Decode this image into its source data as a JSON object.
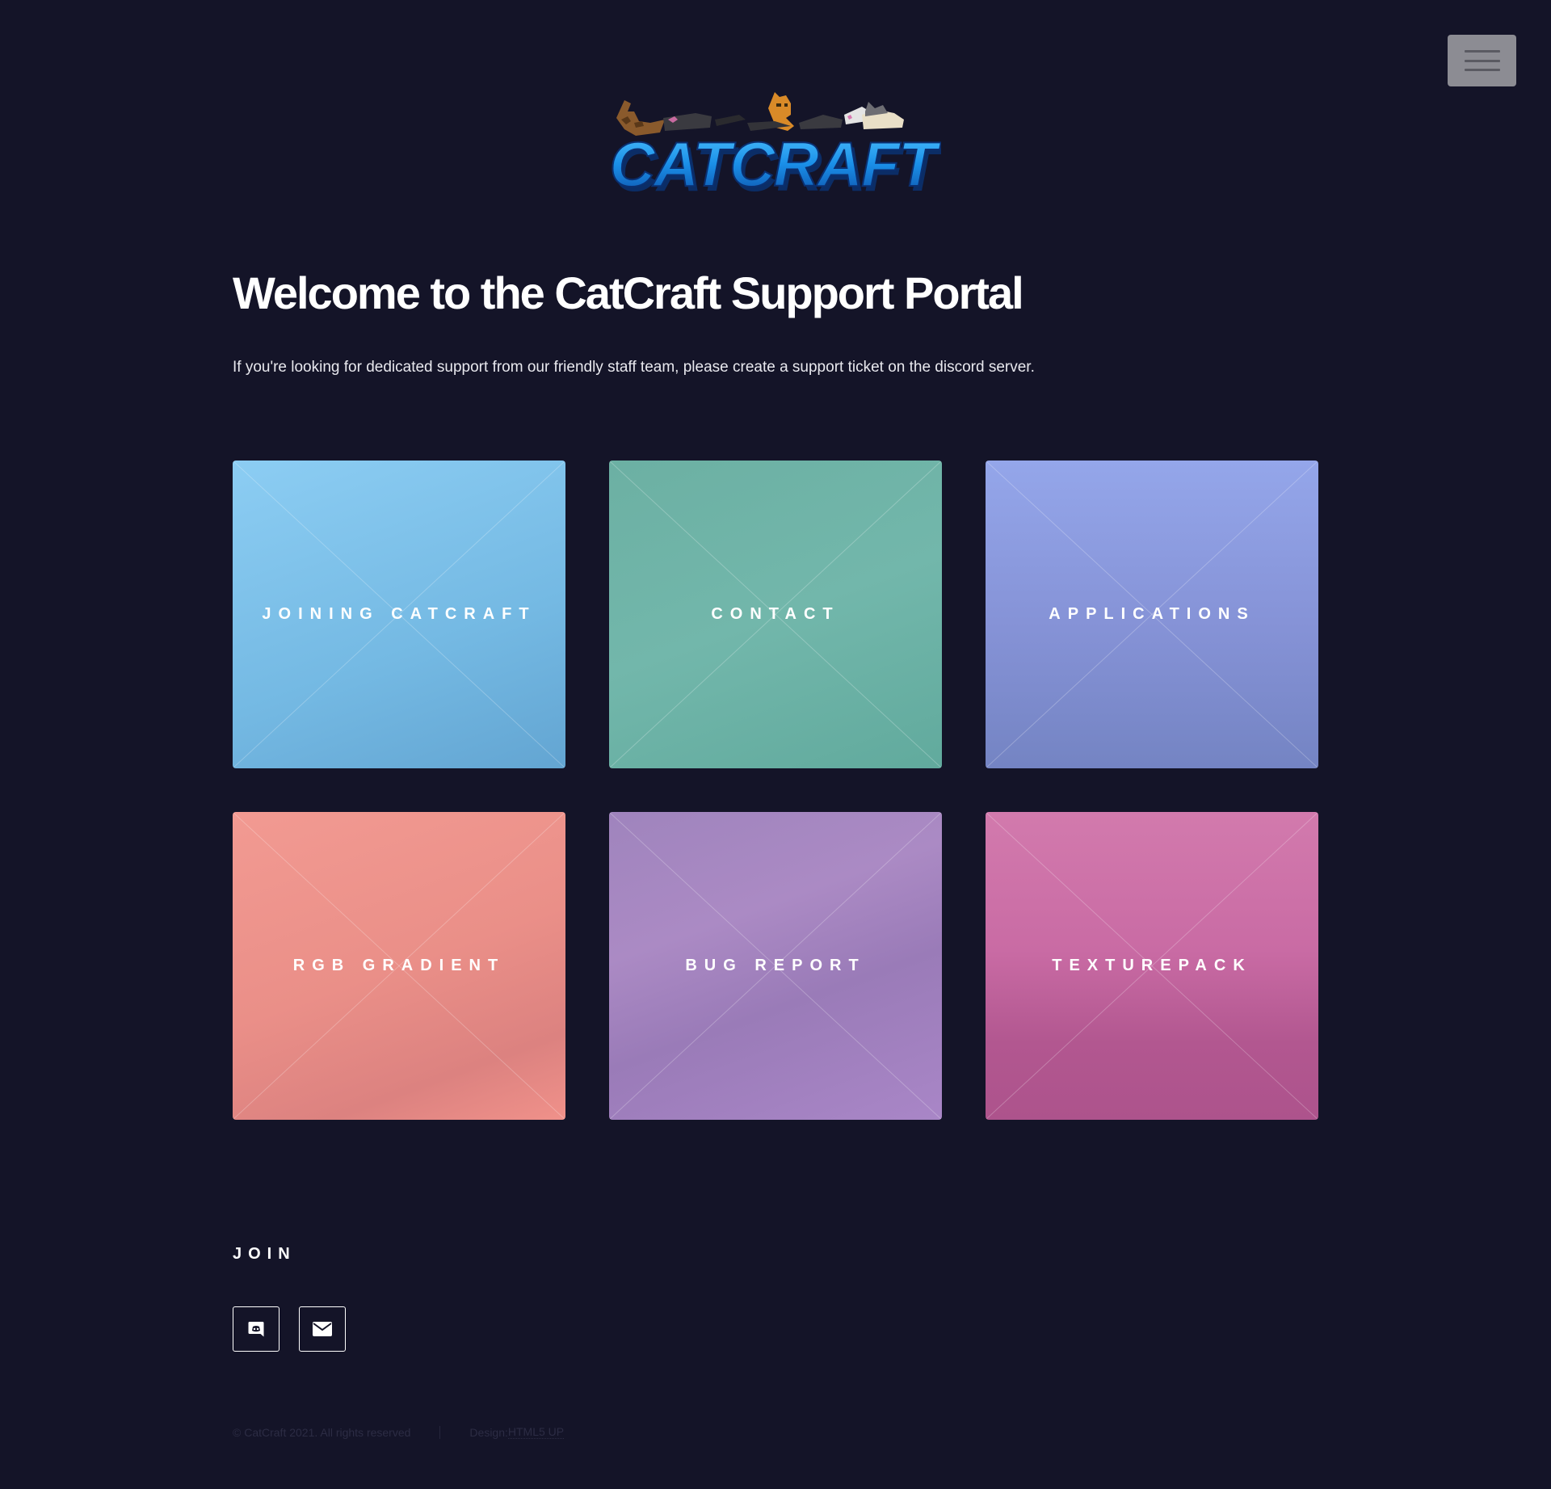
{
  "header": {
    "menu_icon": "hamburger-icon",
    "logo_text": "CATCRAFT"
  },
  "main": {
    "title": "Welcome to the CatCraft Support Portal",
    "intro": "If you're looking for dedicated support from our friendly staff team, please create a support ticket on the discord server."
  },
  "tiles": [
    {
      "label": "Joining CatCraft"
    },
    {
      "label": "Contact"
    },
    {
      "label": "Applications"
    },
    {
      "label": "RGB Gradient"
    },
    {
      "label": "Bug Report"
    },
    {
      "label": "Texturepack"
    }
  ],
  "footer": {
    "join_heading": "JOIN",
    "social": [
      {
        "icon": "discord-icon"
      },
      {
        "icon": "mail-icon"
      }
    ],
    "copyright": "© CatCraft 2021. All rights reserved",
    "design_prefix": "Design: ",
    "design_link": "HTML5 UP"
  },
  "colors": {
    "background": "#141428",
    "tile_blue": "#74b9e3",
    "tile_teal": "#6cb0a3",
    "tile_periwinkle": "#8592d6",
    "tile_salmon": "#ea8f88",
    "tile_purple": "#9f84bd",
    "tile_pink": "#c96ba4",
    "logo_blue": "#1a8fe8"
  }
}
